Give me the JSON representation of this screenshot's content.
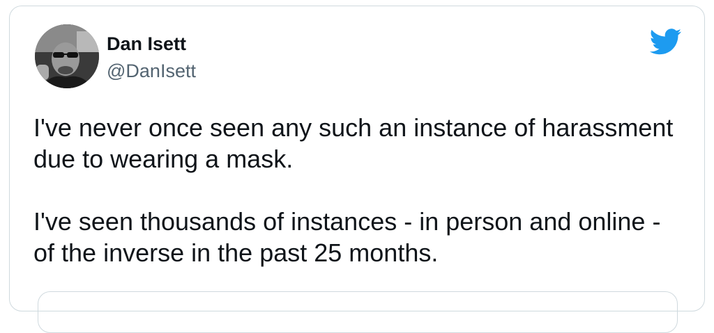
{
  "tweet": {
    "author": {
      "display_name": "Dan Isett",
      "handle": "@DanIsett",
      "avatar_icon": "profile-photo"
    },
    "platform_icon": "twitter-bird-icon",
    "brand_color": "#1d9bf0",
    "paragraphs": [
      "I've never once seen any such an instance of harassment due to wearing a mask.",
      "I've seen thousands of instances - in person and online - of the inverse in the past 25 months."
    ]
  }
}
